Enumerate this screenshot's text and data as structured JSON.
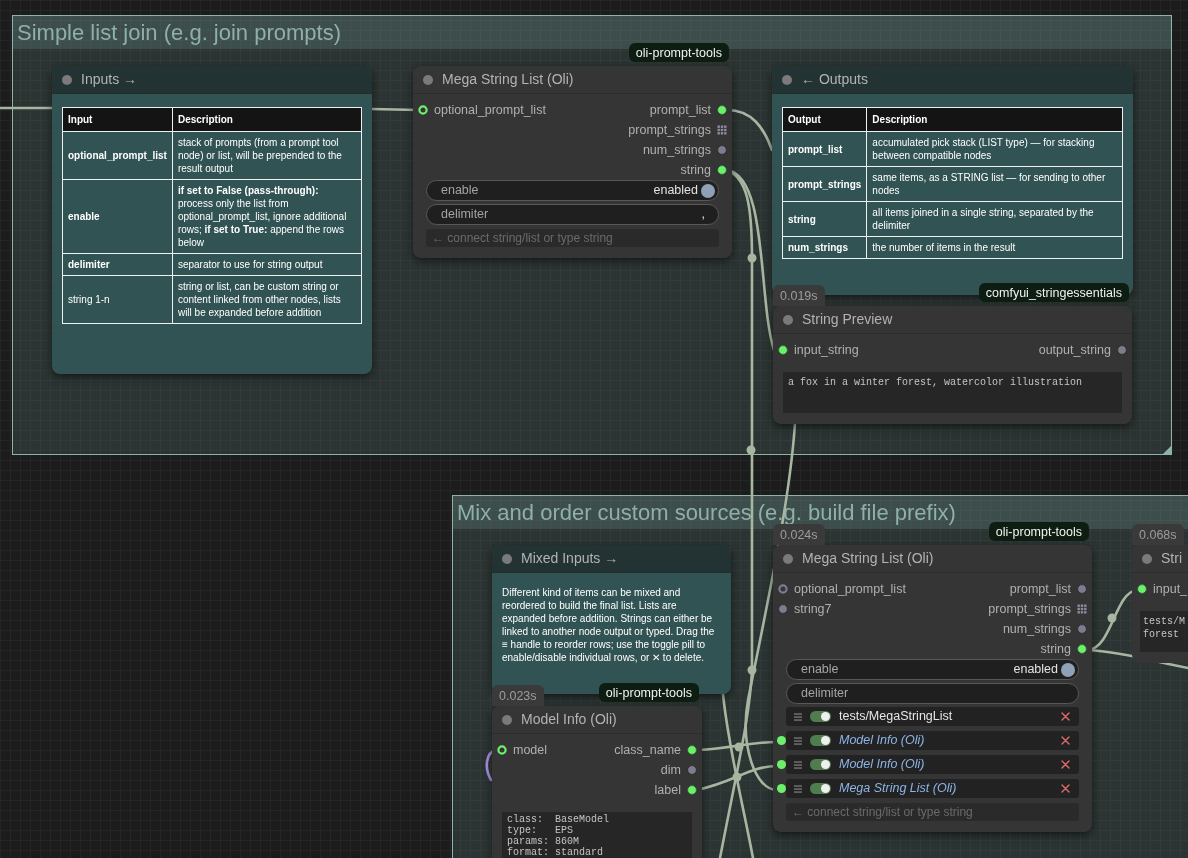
{
  "groups": [
    {
      "title": "Simple list join (e.g. join prompts)",
      "nodes": [
        {
          "kind": "note",
          "title": "Inputs →",
          "table": {
            "columns": [
              "Input",
              "Description"
            ],
            "rows": [
              {
                "name": "optional_prompt_list",
                "bold": true,
                "description": "stack of prompts (from a prompt tool node) or list, will be prepended to the result output"
              },
              {
                "name": "enable",
                "bold": true,
                "description": "**if set to False (pass-through):** process only the list from optional_prompt_list, ignore additional rows; **if set to True:** append the rows below"
              },
              {
                "name": "delimiter",
                "bold": true,
                "description": "separator to use for string output"
              },
              {
                "name": "string 1-n",
                "bold": false,
                "description": "string or list, can be custom string or content linked from other nodes, lists will be expanded before addition"
              }
            ]
          }
        },
        {
          "kind": "node",
          "title": "Mega String List (Oli)",
          "package": "oli-prompt-tools",
          "inputs": [
            {
              "label": "optional_prompt_list",
              "kind": "ring",
              "connected": true
            }
          ],
          "outputs": [
            {
              "label": "prompt_list",
              "kind": "dot",
              "connected": true
            },
            {
              "label": "prompt_strings",
              "kind": "grid",
              "connected": false
            },
            {
              "label": "num_strings",
              "kind": "dot",
              "connected": false
            },
            {
              "label": "string",
              "kind": "dot",
              "connected": true
            }
          ],
          "widgets": [
            {
              "kind": "toggle",
              "label": "enable",
              "value": "enabled",
              "on": true
            },
            {
              "kind": "text",
              "label": "delimiter",
              "value": ","
            }
          ],
          "add_row": {
            "placeholder": "← connect string/list or type string"
          }
        },
        {
          "kind": "note",
          "title": "← Outputs",
          "table": {
            "columns": [
              "Output",
              "Description"
            ],
            "rows": [
              {
                "name": "prompt_list",
                "bold": true,
                "description": "accumulated pick stack (LIST type) — for stacking between compatible nodes"
              },
              {
                "name": "prompt_strings",
                "bold": true,
                "description": "same items, as a STRING list — for sending to other nodes"
              },
              {
                "name": "string",
                "bold": true,
                "description": "all items joined in a single string, separated by the delimiter"
              },
              {
                "name": "num_strings",
                "bold": true,
                "description": "the number of items in the result"
              }
            ]
          }
        },
        {
          "kind": "node",
          "title": "String Preview",
          "package": "comfyui_stringessentials",
          "time": "0.019s",
          "inputs": [
            {
              "label": "input_string",
              "kind": "dot",
              "connected": true
            }
          ],
          "outputs": [
            {
              "label": "output_string",
              "kind": "dot",
              "connected": false
            }
          ],
          "preview": "a fox in a winter forest, watercolor illustration"
        }
      ]
    },
    {
      "title": "Mix and order custom sources (e.g. build file prefix)",
      "nodes": [
        {
          "kind": "note",
          "title": "Mixed Inputs →",
          "text": "Different kind of items can be mixed and reordered to build the final list. Lists are expanded before addition. Strings can either be linked to another node output or typed. Drag the ≡ handle to reorder rows; use the toggle pill to enable/disable individual rows, or ✕ to delete."
        },
        {
          "kind": "node",
          "title": "Model Info (Oli)",
          "package": "oli-prompt-tools",
          "time": "0.023s",
          "inputs": [
            {
              "label": "model",
              "kind": "ring",
              "connected": true
            }
          ],
          "outputs": [
            {
              "label": "class_name",
              "kind": "dot",
              "connected": true
            },
            {
              "label": "dim",
              "kind": "dot",
              "connected": false
            },
            {
              "label": "label",
              "kind": "dot",
              "connected": true
            }
          ],
          "preview": "class:  BaseModel\ntype:   EPS\nparams: 860M\nformat: standard"
        },
        {
          "kind": "node",
          "title": "Mega String List (Oli)",
          "package": "oli-prompt-tools",
          "time": "0.024s",
          "inputs": [
            {
              "label": "optional_prompt_list",
              "kind": "ring",
              "connected": false
            },
            {
              "label": "string7",
              "kind": "dot",
              "connected": false
            }
          ],
          "outputs": [
            {
              "label": "prompt_list",
              "kind": "dot",
              "connected": false
            },
            {
              "label": "prompt_strings",
              "kind": "grid",
              "connected": false
            },
            {
              "label": "num_strings",
              "kind": "dot",
              "connected": false
            },
            {
              "label": "string",
              "kind": "dot",
              "connected": true
            }
          ],
          "widgets": [
            {
              "kind": "toggle",
              "label": "enable",
              "value": "enabled",
              "on": true
            },
            {
              "kind": "text",
              "label": "delimiter"
            }
          ],
          "rows": [
            {
              "kind": "typed",
              "text": "tests/MegaStringList",
              "on": true
            },
            {
              "kind": "linked",
              "text": "Model Info (Oli)",
              "on": true
            },
            {
              "kind": "linked",
              "text": "Model Info (Oli)",
              "on": true
            },
            {
              "kind": "linked",
              "text": "Mega String List (Oli)",
              "on": true
            }
          ],
          "add_row": {
            "placeholder": "← connect string/list or type string"
          }
        },
        {
          "kind": "node",
          "title": "Stri",
          "time": "0.068s",
          "inputs": [
            {
              "label": "input_",
              "kind": "dot",
              "connected": true
            }
          ],
          "preview": "tests/M\nforest"
        }
      ]
    }
  ]
}
